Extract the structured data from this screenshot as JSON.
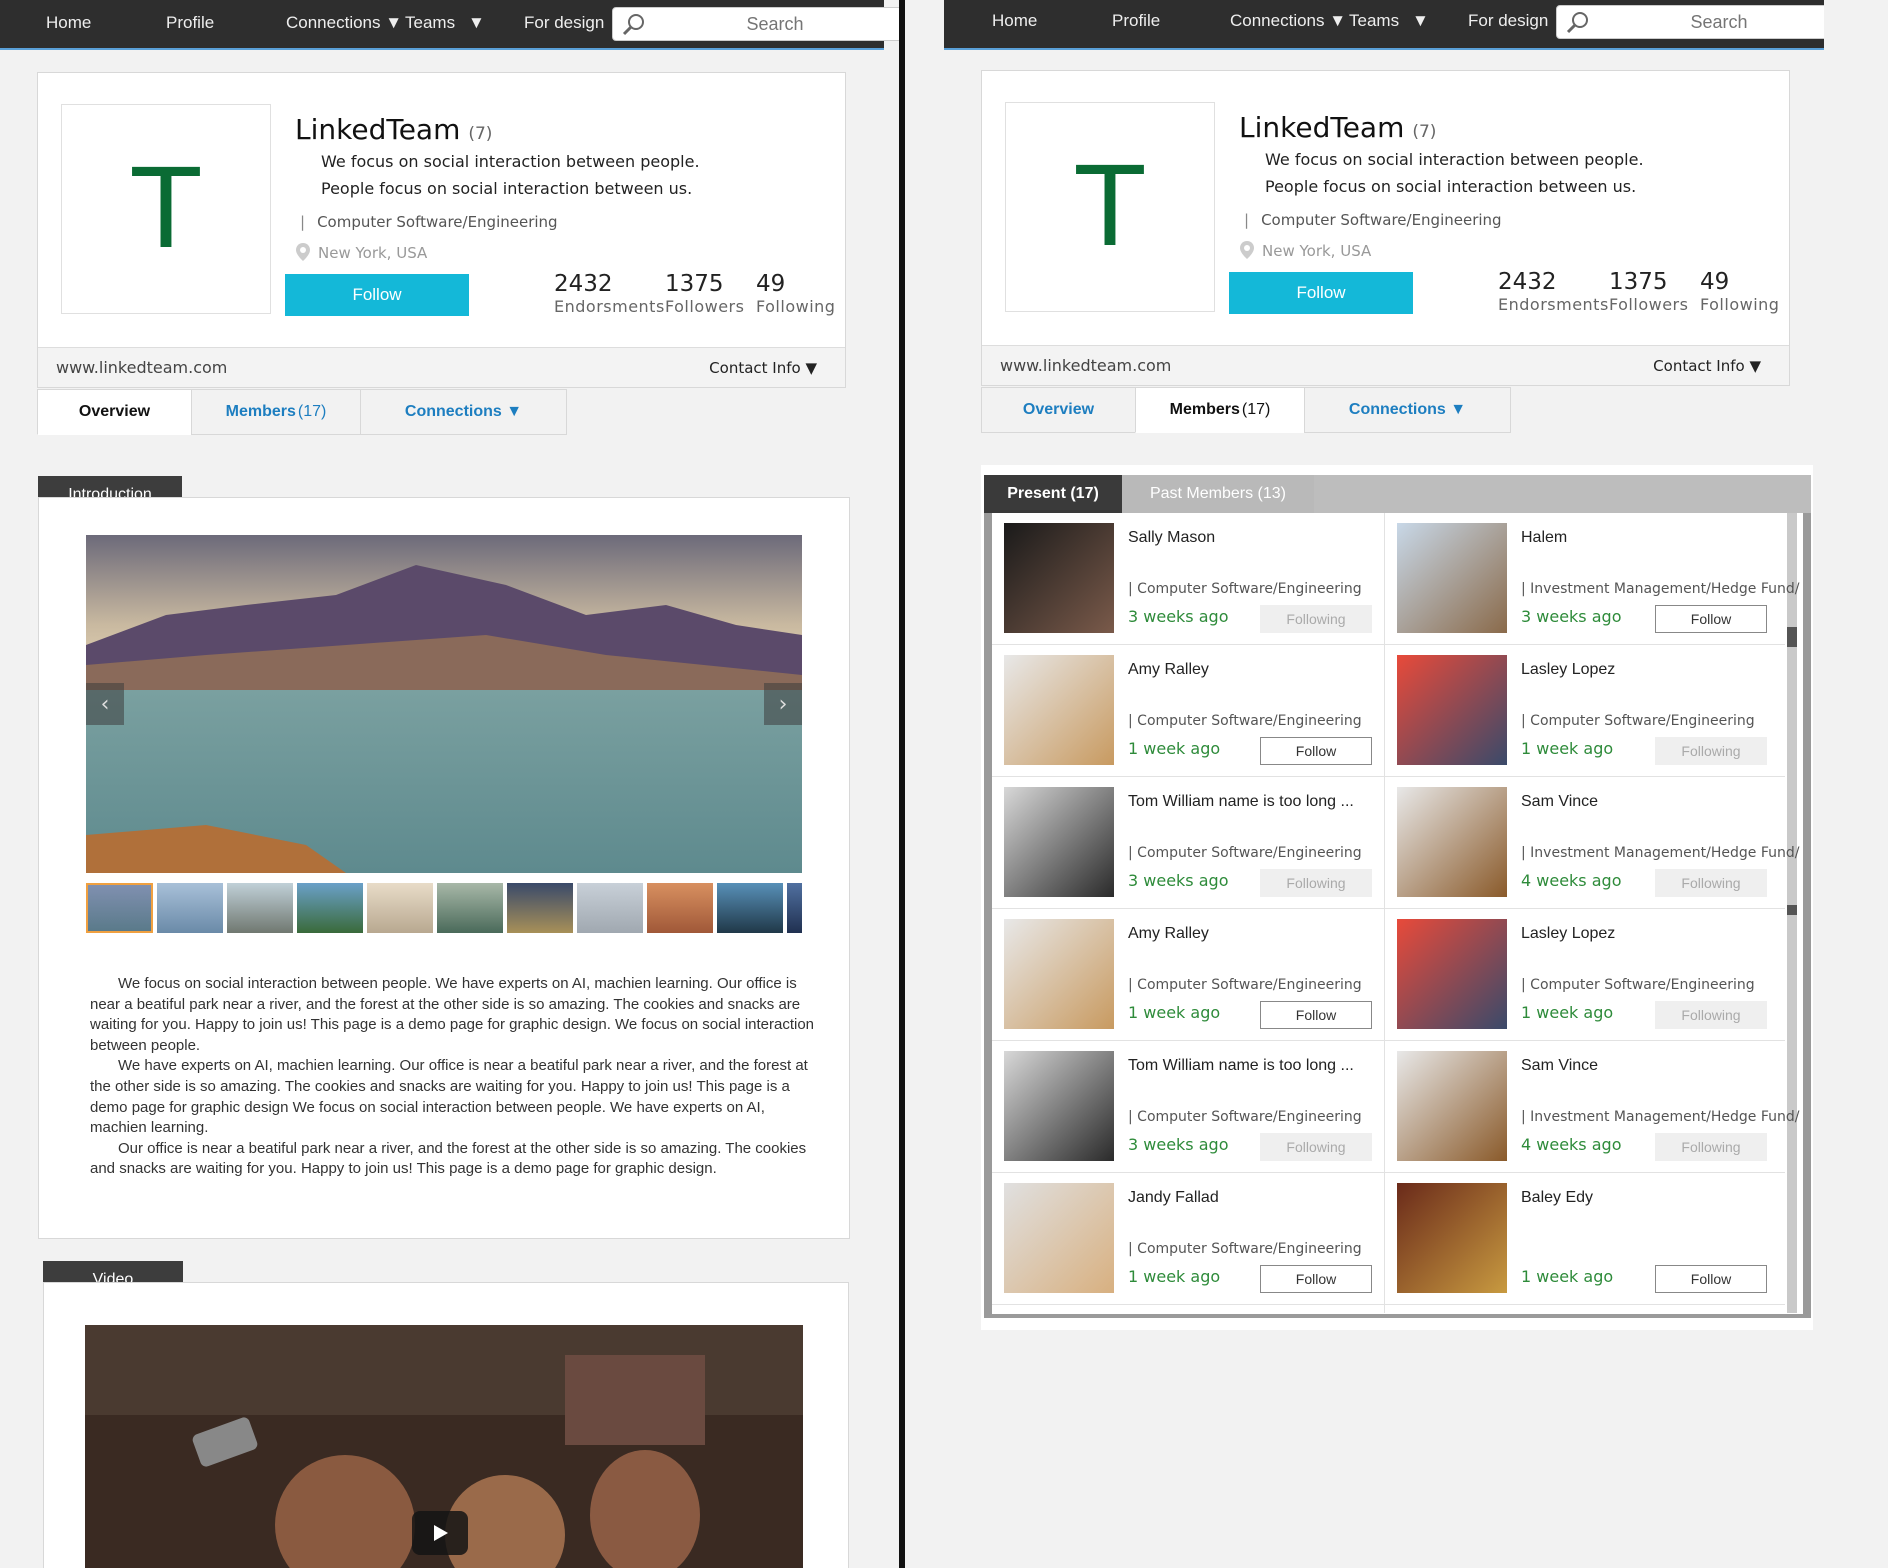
{
  "nav": {
    "home": "Home",
    "profile": "Profile",
    "connections": "Connections ▼",
    "teams": "Teams",
    "teams_caret": "▼",
    "for_design": "For design",
    "search_placeholder": "Search"
  },
  "company": {
    "name": "LinkedTeam",
    "count": "(7)",
    "logo_letter": "T",
    "tagline_1": "We focus on social interaction between people.",
    "tagline_2": "People focus on social interaction between us.",
    "industry": "Computer Software/Engineering",
    "location": "New York, USA",
    "follow_label": "Follow",
    "stats": [
      {
        "value": "2432",
        "label": "Endorsments"
      },
      {
        "value": "1375",
        "label": "Followers"
      },
      {
        "value": "49",
        "label": "Following"
      }
    ],
    "website": "www.linkedteam.com",
    "contact_info": "Contact Info ▼"
  },
  "tabs": {
    "overview": "Overview",
    "members": "Members",
    "members_count": "(17)",
    "connections": "Connections ▼"
  },
  "intro": {
    "heading": "Introduction",
    "paragraphs": [
      "We focus on social interaction between people. We have experts on AI, machien learning. Our office is near a beatiful park near a river, and the forest at the other side is so amazing. The cookies and snacks are waiting for you. Happy to join us! This page is a demo page for graphic design. We focus on social interaction between people.",
      "We have experts on AI, machien learning. Our office is near a beatiful park near a river, and the forest at the other side is so amazing. The cookies and snacks are waiting for you. Happy to join us! This page is a demo page for graphic design We focus on social interaction between people. We have experts on AI, machien learning.",
      "Our office is near a beatiful park near a river, and the forest at the other side is so amazing. The cookies and snacks are waiting for you. Happy to join us! This page is a demo page for graphic design."
    ],
    "prev_arrow": "‹",
    "next_arrow": "›"
  },
  "video": {
    "heading": "Video"
  },
  "members_panel": {
    "present_tab": "Present (17)",
    "past_tab": "Past Members (13)",
    "members": [
      {
        "name": "Sally Mason",
        "industry": "| Computer Software/Engineering",
        "time": "3 weeks ago",
        "button": "Following"
      },
      {
        "name": "Halem",
        "industry": "| Investment Management/Hedge Fund/",
        "time": "3 weeks ago",
        "button": "Follow"
      },
      {
        "name": "Amy Ralley",
        "industry": "| Computer Software/Engineering",
        "time": "1 week ago",
        "button": "Follow"
      },
      {
        "name": "Lasley Lopez",
        "industry": "| Computer Software/Engineering",
        "time": "1 week ago",
        "button": "Following"
      },
      {
        "name": "Tom William name is too long ...",
        "industry": "| Computer Software/Engineering",
        "time": "3 weeks ago",
        "button": "Following"
      },
      {
        "name": "Sam Vince",
        "industry": "| Investment Management/Hedge Fund/",
        "time": "4 weeks ago",
        "button": "Following"
      },
      {
        "name": "Amy Ralley",
        "industry": "| Computer Software/Engineering",
        "time": "1 week ago",
        "button": "Follow"
      },
      {
        "name": "Lasley Lopez",
        "industry": "| Computer Software/Engineering",
        "time": "1 week ago",
        "button": "Following"
      },
      {
        "name": "Tom William name is too long ...",
        "industry": "| Computer Software/Engineering",
        "time": "3 weeks ago",
        "button": "Following"
      },
      {
        "name": "Sam Vince",
        "industry": "| Investment Management/Hedge Fund/",
        "time": "4 weeks ago",
        "button": "Following"
      },
      {
        "name": "Jandy Fallad",
        "industry": "| Computer Software/Engineering",
        "time": "1 week ago",
        "button": "Follow"
      },
      {
        "name": "Baley Edy",
        "industry": "",
        "time": "1 week ago",
        "button": "Follow"
      }
    ]
  },
  "colors": {
    "nav_bg": "#2e2e2e",
    "accent_cyan": "#14b8d8",
    "logo_green": "#0a6b34",
    "link_blue": "#1d7ec0",
    "time_green": "#2e8b3a"
  }
}
